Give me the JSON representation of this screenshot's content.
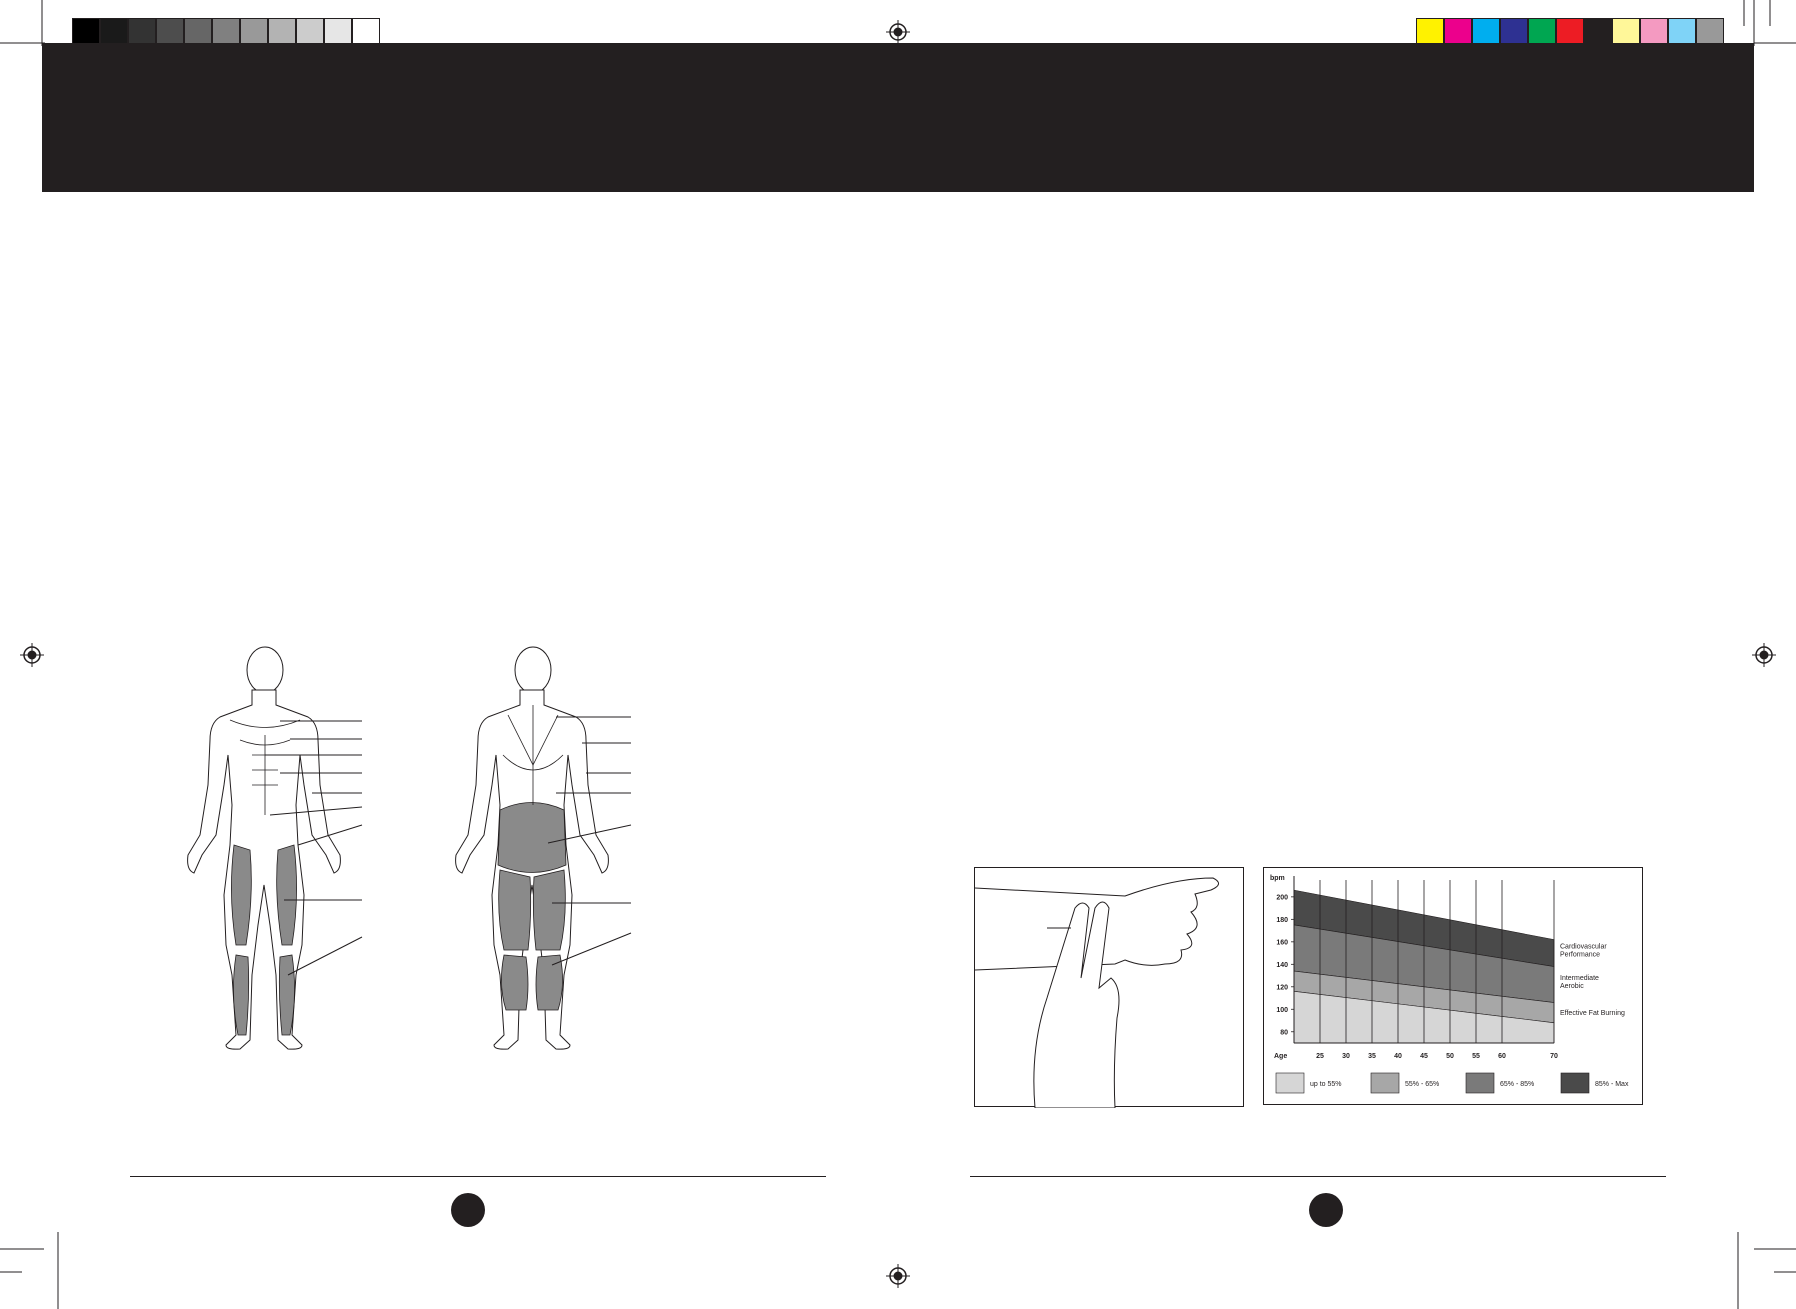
{
  "registration": {
    "grey_steps": [
      "#000000",
      "#1a1a1a",
      "#333333",
      "#4d4d4d",
      "#666666",
      "#808080",
      "#999999",
      "#b3b3b3",
      "#cccccc",
      "#e6e6e6",
      "#ffffff"
    ],
    "color_steps": [
      "#fff200",
      "#ec008c",
      "#00aeef",
      "#2e3192",
      "#00a651",
      "#ed1c24",
      "#231f20",
      "#fff799",
      "#f49ac1",
      "#7fd3f7",
      "#999999"
    ]
  },
  "header_band": {
    "color": "#231f20"
  },
  "anatomy": {
    "front_icon": "muscle-front-figure-icon",
    "back_icon": "muscle-back-figure-icon"
  },
  "pulse_illustration": {
    "icon": "wrist-pulse-hand-icon"
  },
  "chart_data": {
    "type": "area",
    "ylabel": "bpm",
    "xlabel": "Age",
    "x": [
      25,
      30,
      35,
      40,
      45,
      50,
      55,
      60,
      70
    ],
    "x_tick_labels": [
      "25",
      "30",
      "35",
      "40",
      "45",
      "50",
      "55",
      "60",
      "70"
    ],
    "y_ticks": [
      80,
      100,
      120,
      140,
      160,
      180,
      200
    ],
    "ylim": [
      70,
      215
    ],
    "xlim": [
      20,
      70
    ],
    "boundaries": {
      "x_endpoints": [
        20,
        70
      ],
      "max": [
        206,
        162
      ],
      "pct85": [
        175,
        138
      ],
      "pct65": [
        134,
        106
      ],
      "pct55": [
        116,
        88
      ]
    },
    "zone_labels": [
      {
        "lines": [
          "Cardiovascular",
          "Performance"
        ]
      },
      {
        "lines": [
          "Intermediate",
          "Aerobic"
        ]
      },
      {
        "lines": [
          "Effective Fat Burning"
        ]
      }
    ],
    "legend": [
      {
        "label": "up to 55%",
        "color": "#d6d6d6"
      },
      {
        "label": "55% - 65%",
        "color": "#a7a7a7"
      },
      {
        "label": "65% - 85%",
        "color": "#7a7a7a"
      },
      {
        "label": "85% - Max",
        "color": "#4a4a4a"
      }
    ],
    "grid": true,
    "legend_placement": "bottom"
  }
}
